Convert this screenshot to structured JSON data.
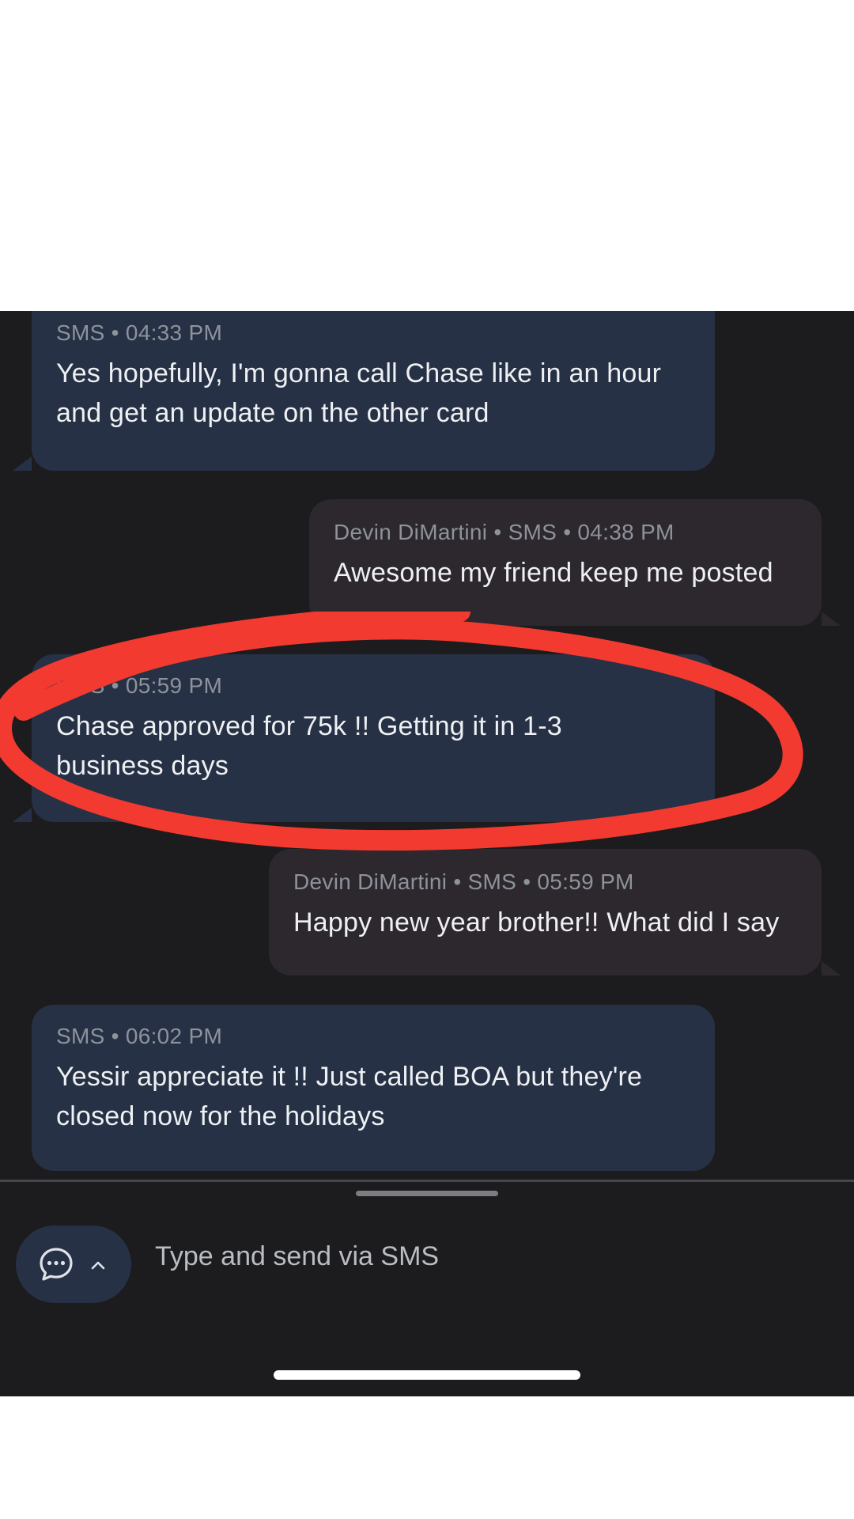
{
  "messages": [
    {
      "meta": "SMS • 04:33 PM",
      "text": "Yes hopefully, I'm gonna call Chase like in an hour and get an update on the other card"
    },
    {
      "meta": "Devin DiMartini • SMS • 04:38 PM",
      "text": "Awesome my friend keep me posted"
    },
    {
      "meta": "SMS • 05:59 PM",
      "text": "Chase approved for 75k !! Getting it in 1-3 business days"
    },
    {
      "meta": "Devin DiMartini • SMS • 05:59 PM",
      "text": "Happy new year brother!! What did I say"
    },
    {
      "meta": "SMS • 06:02 PM",
      "text": "Yessir appreciate it !! Just called BOA but they're closed now for the holidays"
    }
  ],
  "compose": {
    "placeholder": "Type and send via SMS"
  },
  "colors": {
    "incoming_bubble": "#263145",
    "outgoing_bubble": "#2d282d",
    "annotation": "#f23a30",
    "background": "#1c1c1e"
  },
  "icons": {
    "compose": "chat-bubble-dots-icon",
    "expand": "chevron-up-icon"
  }
}
